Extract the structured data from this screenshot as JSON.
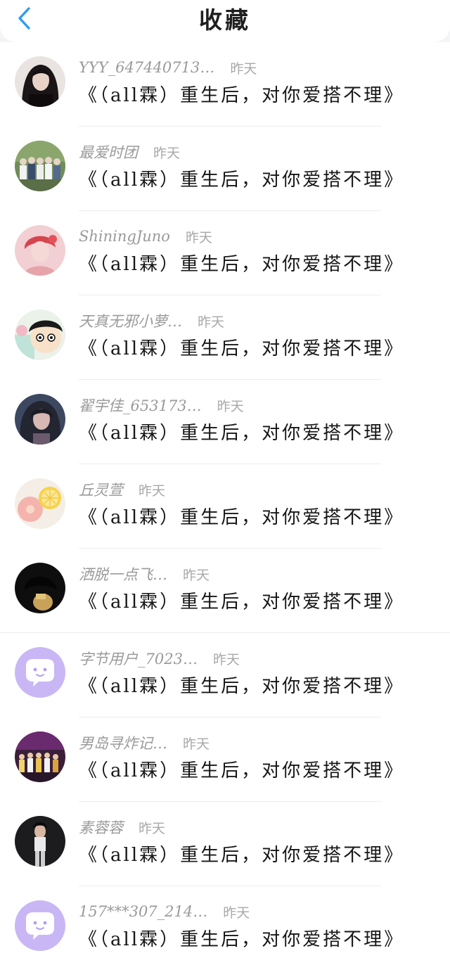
{
  "header": {
    "title": "收藏",
    "back_icon": "chevron-left-icon",
    "accent": "#2f9bf0"
  },
  "items": [
    {
      "user": "YYY_647440713…",
      "time": "昨天",
      "book": "《（all霖）重生后，对你爱搭不理》",
      "avatar": "dark-haired-woman-photo"
    },
    {
      "user": "最爱时团",
      "time": "昨天",
      "book": "《（all霖）重生后，对你爱搭不理》",
      "avatar": "group-photo-outdoor"
    },
    {
      "user": "ShiningJuno",
      "time": "昨天",
      "book": "《（all霖）重生后，对你爱搭不理》",
      "avatar": "pink-portrait-photo"
    },
    {
      "user": "天真无邪小萝…",
      "time": "昨天",
      "book": "《（all霖）重生后，对你爱搭不理》",
      "avatar": "cartoon-boy-avatar"
    },
    {
      "user": "翟宇佳_653173…",
      "time": "昨天",
      "book": "《（all霖）重生后，对你爱搭不理》",
      "avatar": "painted-girl-portrait"
    },
    {
      "user": "丘灵萱",
      "time": "昨天",
      "book": "《（all霖）重生后，对你爱搭不理》",
      "avatar": "flower-lemon-photo"
    },
    {
      "user": "洒脱一点飞…",
      "time": "昨天",
      "book": "《（all霖）重生后，对你爱搭不理》",
      "avatar": "dark-silhouette-photo"
    },
    {
      "user": "字节用户_7023…",
      "time": "昨天",
      "book": "《（all霖）重生后，对你爱搭不理》",
      "avatar": "default-chat-bubble-avatar"
    },
    {
      "user": "男岛寻炸记…",
      "time": "昨天",
      "book": "《（all霖）重生后，对你爱搭不理》",
      "avatar": "stage-group-photo"
    },
    {
      "user": "素蓉蓉",
      "time": "昨天",
      "book": "《（all霖）重生后，对你爱搭不理》",
      "avatar": "woman-standing-photo"
    },
    {
      "user": "157***307_214…",
      "time": "昨天",
      "book": "《（all霖）重生后，对你爱搭不理》",
      "avatar": "default-chat-bubble-avatar"
    }
  ]
}
